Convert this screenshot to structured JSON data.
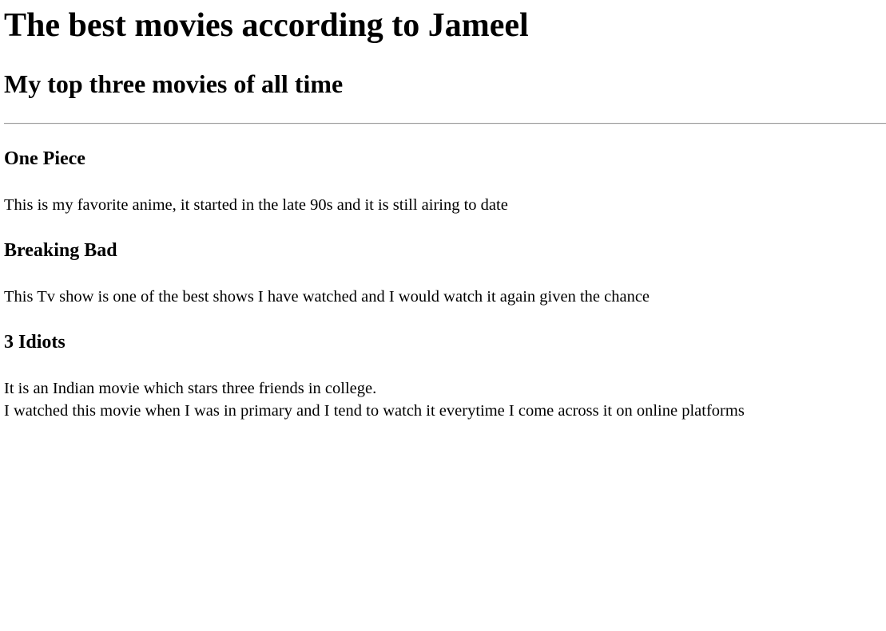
{
  "page": {
    "title": "The best movies according to Jameel",
    "subtitle": "My top three movies of all time"
  },
  "movies": [
    {
      "title": "One Piece",
      "description": "This is my favorite anime, it started in the late 90s and it is still airing to date"
    },
    {
      "title": "Breaking Bad",
      "description": "This Tv show is one of the best shows I have watched and I would watch it again given the chance"
    },
    {
      "title": "3 Idiots",
      "description_line1": "It is an Indian movie which stars three friends in college.",
      "description_line2": "I watched this movie when I was in primary and I tend to watch it everytime I come across it on online platforms"
    }
  ]
}
